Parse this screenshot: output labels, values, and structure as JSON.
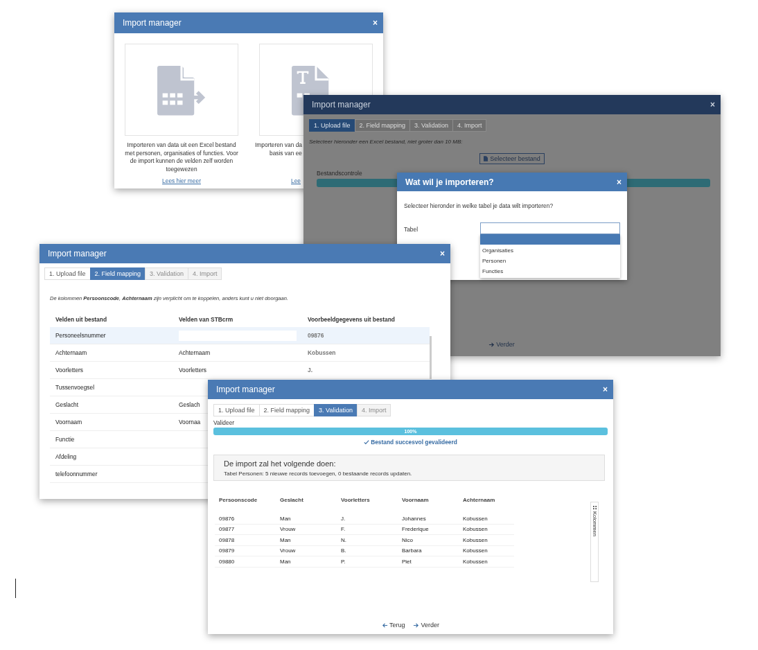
{
  "chooser_window": {
    "title": "Import manager",
    "close": "×",
    "cards": [
      {
        "lines": [
          "Importeren van data uit een Excel bestand met personen, organisaties of functies. Voor de import kunnen de velden zelf worden toegewezen"
        ],
        "link": "Lees hier meer"
      },
      {
        "lines": [
          "Importeren van da",
          "basis van ee"
        ],
        "link": "Lee"
      }
    ]
  },
  "upload_window": {
    "title": "Import manager",
    "close": "×",
    "tabs": [
      {
        "label": "1. Upload file",
        "selected": true,
        "disabled": false
      },
      {
        "label": "2. Field mapping",
        "selected": false,
        "disabled": true
      },
      {
        "label": "3. Validation",
        "selected": false,
        "disabled": true
      },
      {
        "label": "4. Import",
        "selected": false,
        "disabled": true
      }
    ],
    "instruction": "Selecteer hieronder een Excel bestand, niet groter dan 10 MB:",
    "select_button": "Selecteer bestand",
    "check_label": "Bestandscontrole",
    "check_progress": {
      "level": 1
    },
    "next": "Verder",
    "dialog": {
      "title": "Wat wil je importeren?",
      "close": "×",
      "prompt": "Selecteer hieronder in welke tabel je data wilt importeren?",
      "field_label": "Tabel",
      "options": [
        {
          "label": "Organisaties",
          "selected": false
        },
        {
          "label": "Personen",
          "selected": false
        },
        {
          "label": "Functies",
          "selected": false
        }
      ]
    }
  },
  "mapping_window": {
    "title": "Import manager",
    "close": "×",
    "tabs": [
      {
        "label": "1. Upload file",
        "selected": false,
        "disabled": false
      },
      {
        "label": "2. Field mapping",
        "selected": true,
        "disabled": false
      },
      {
        "label": "3. Validation",
        "selected": false,
        "disabled": true
      },
      {
        "label": "4. Import",
        "selected": false,
        "disabled": true
      }
    ],
    "notice": "De kolommen **Persoonscode**, **Achternaam** zijn verplicht om te koppelen, anders kunt u niet doorgaan.",
    "columns": [
      "Velden uit bestand",
      "Velden van STBcrm",
      "Voorbeeldgegevens uit bestand"
    ],
    "rows": [
      {
        "kind": "field",
        "source": "Personeelsnummer",
        "example": "09876",
        "selected": true
      },
      {
        "kind": "text",
        "source": "Achternaam",
        "target": "Achternaam",
        "example": "Kobussen",
        "selected": false
      },
      {
        "kind": "text",
        "source": "Voorletters",
        "target": "Voorletters",
        "example": "J.",
        "selected": false
      },
      {
        "kind": "text",
        "source": "Tussenvoegsel",
        "selected": false
      },
      {
        "kind": "text",
        "source": "Geslacht",
        "target": "Geslach",
        "selected": false
      },
      {
        "kind": "text",
        "source": "Voornaam",
        "target": "Voornaa",
        "selected": false
      },
      {
        "kind": "text",
        "source": "Functie",
        "selected": false
      },
      {
        "kind": "text",
        "source": "Afdeling",
        "selected": false
      },
      {
        "kind": "text",
        "source": "telefoonnummer",
        "selected": false
      }
    ]
  },
  "validation_window": {
    "title": "Import manager",
    "close": "×",
    "tabs": [
      {
        "label": "1. Upload file",
        "selected": false,
        "disabled": false
      },
      {
        "label": "2. Field mapping",
        "selected": false,
        "disabled": false
      },
      {
        "label": "3. Validation",
        "selected": true,
        "disabled": false
      },
      {
        "label": "4. Import",
        "selected": false,
        "disabled": true
      }
    ],
    "progress_label": "Valideer",
    "progress": {
      "level": 1,
      "reading": "100%"
    },
    "success": "Bestand succesvol gevalideerd",
    "summary": {
      "title": "De import zal het volgende doen:",
      "text": "Tabel Personen: 5 nieuwe records toevoegen, 0 bestaande records updaten."
    },
    "columns": [
      "Persoonscode",
      "Geslacht",
      "Voorletters",
      "Voornaam",
      "Achternaam"
    ],
    "rows": [
      [
        "09876",
        "Man",
        "J.",
        "Johannes",
        "Kobussen"
      ],
      [
        "09877",
        "Vrouw",
        "F.",
        "Frederique",
        "Kobussen"
      ],
      [
        "09878",
        "Man",
        "N.",
        "Nico",
        "Kobussen"
      ],
      [
        "09879",
        "Vrouw",
        "B.",
        "Barbara",
        "Kobussen"
      ],
      [
        "09880",
        "Man",
        "P.",
        "Piet",
        "Kobussen"
      ]
    ],
    "side_button": "Kolommen",
    "back": "Terug",
    "next": "Verder"
  }
}
